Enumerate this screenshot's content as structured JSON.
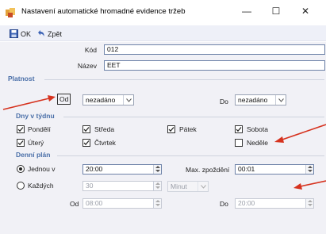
{
  "window": {
    "title": "Nastavení automatické hromadné evidence tržeb",
    "minimize": "—",
    "maximize": "☐",
    "close": "✕"
  },
  "toolbar": {
    "ok_label": "OK",
    "back_label": "Zpět"
  },
  "form": {
    "kod_label": "Kód",
    "kod_value": "012",
    "nazev_label": "Název",
    "nazev_value": "EET"
  },
  "platnost": {
    "title": "Platnost",
    "od_label": "Od",
    "od_value": "nezadáno",
    "do_label": "Do",
    "do_value": "nezadáno"
  },
  "dny": {
    "title": "Dny v týdnu",
    "days": [
      {
        "label": "Pondělí",
        "checked": true
      },
      {
        "label": "Úterý",
        "checked": true
      },
      {
        "label": "Středa",
        "checked": true
      },
      {
        "label": "Čtvrtek",
        "checked": true
      },
      {
        "label": "Pátek",
        "checked": true
      },
      {
        "label": "Sobota",
        "checked": true
      },
      {
        "label": "Neděle",
        "checked": false
      }
    ]
  },
  "plan": {
    "title": "Denní plán",
    "jednou_label": "Jednou v",
    "jednou_value": "20:00",
    "max_label": "Max. zpoždění",
    "max_value": "00:01",
    "kazdych_label": "Každých",
    "kazdych_value": "30",
    "unit_value": "Minut",
    "od_label": "Od",
    "od_value": "08:00",
    "do_label": "Do",
    "do_value": "20:00",
    "selected": "jednou"
  },
  "colors": {
    "accent": "#4a6fa8",
    "arrow": "#d6321e"
  }
}
